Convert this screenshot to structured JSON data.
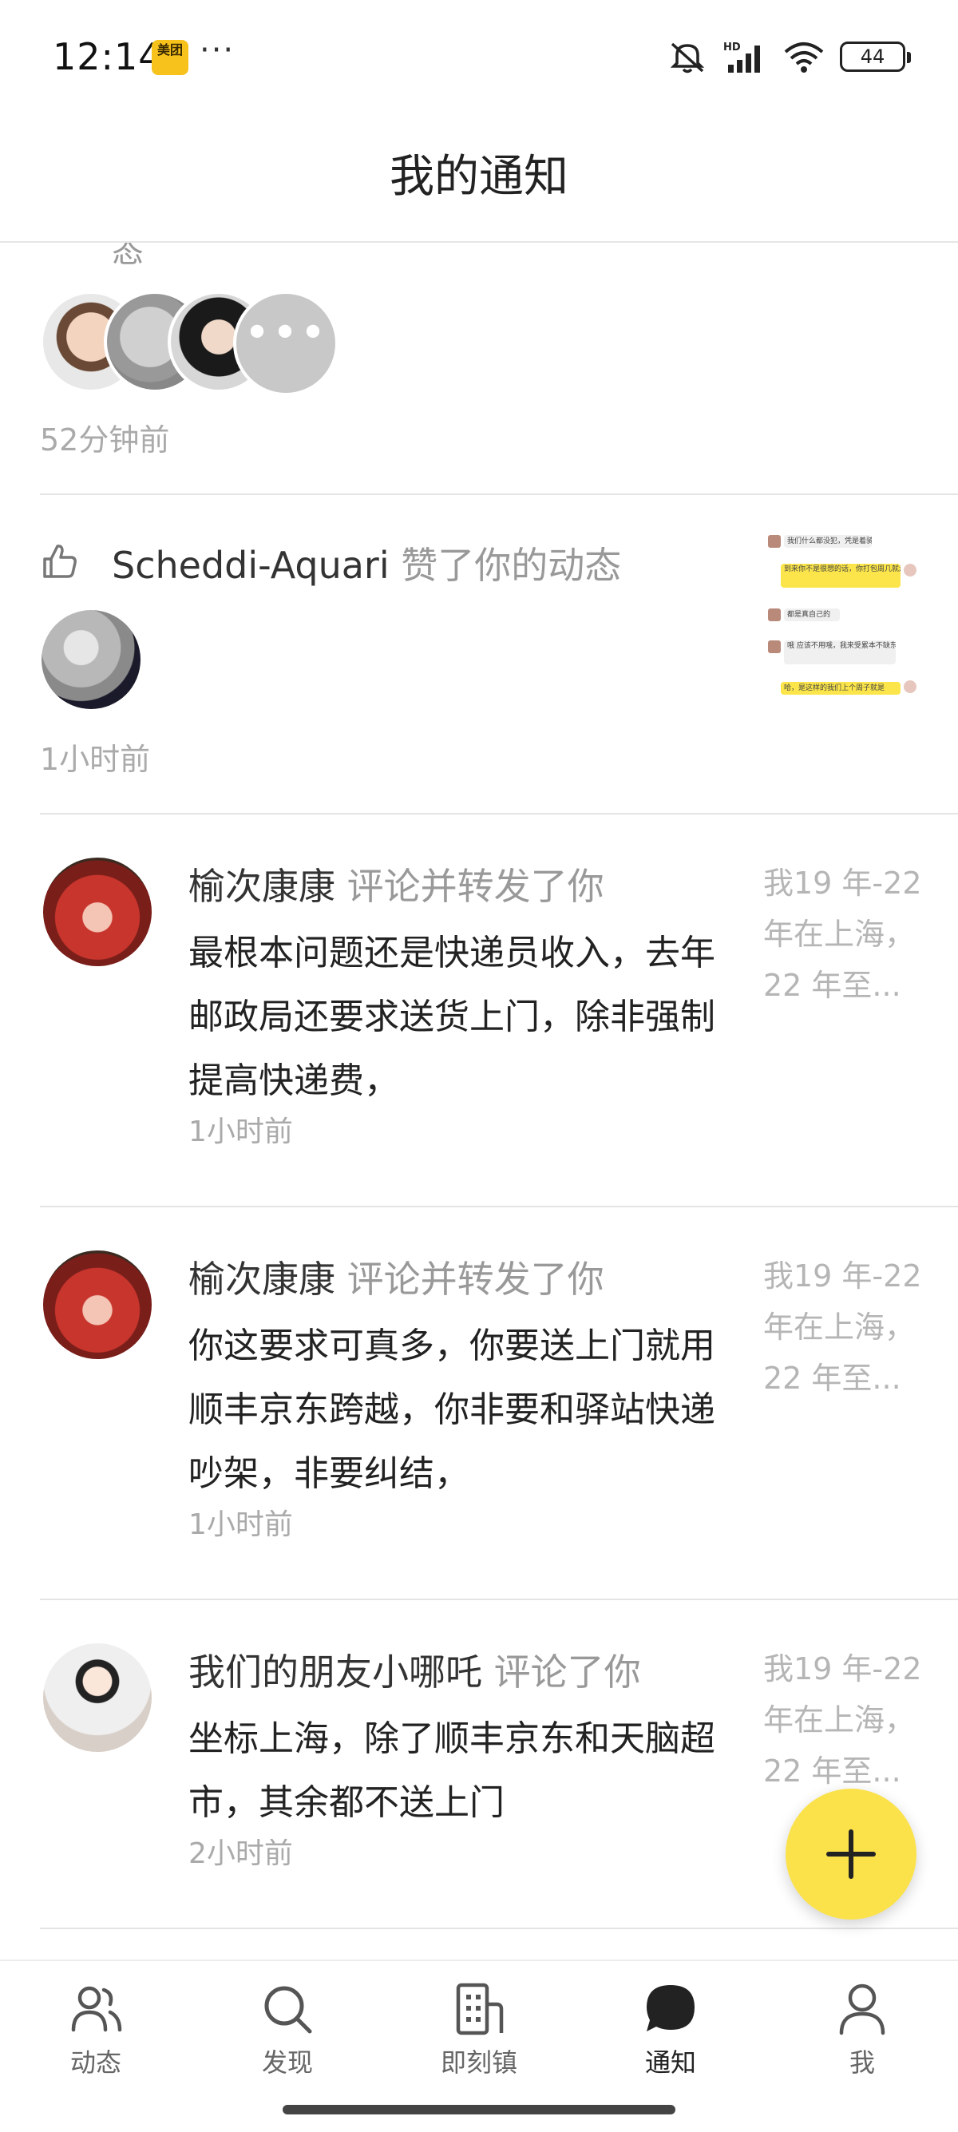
{
  "status_bar": {
    "time": "12:14",
    "app_badge": "美团",
    "battery": "44"
  },
  "header": {
    "title": "我的通知"
  },
  "notifications": [
    {
      "type": "group-like",
      "partial_text": "态",
      "time": "52分钟前"
    },
    {
      "type": "like",
      "user": "Scheddi-Aquari",
      "action": "赞了你的动态",
      "time": "1小时前",
      "thumb_lines": [
        "我们什么都没犯，凭是着骑小",
        "到来你不是很想的话，你打包周几就走好了 可以验件哪里点",
        "都是真自己的",
        "哦 应该不用哦，我来受累本不缺东西，差就行",
        "哈，是这样的我们上个周子就是"
      ]
    },
    {
      "type": "comment",
      "user": "榆次康康",
      "action": "评论并转发了你",
      "content": "最根本问题还是快递员收入，去年邮政局还要求送货上门，除非强制提高快递费，",
      "time": "1小时前",
      "quote": "我19 年-22 年在上海，22 年至..."
    },
    {
      "type": "comment",
      "user": "榆次康康",
      "action": "评论并转发了你",
      "content": "你这要求可真多，你要送上门就用顺丰京东跨越，你非要和驿站快递吵架，非要纠结，",
      "time": "1小时前",
      "quote": "我19 年-22 年在上海，22 年至..."
    },
    {
      "type": "comment",
      "user": "我们的朋友小哪吒",
      "action": "评论了你",
      "content": "坐标上海，除了顺丰京东和天脑超市，其余都不送上门",
      "time": "2小时前",
      "quote": "我19 年-22 年在上海，22 年至..."
    }
  ],
  "bottom_nav": [
    {
      "label": "动态",
      "icon": "people-icon"
    },
    {
      "label": "发现",
      "icon": "search-icon"
    },
    {
      "label": "即刻镇",
      "icon": "building-icon"
    },
    {
      "label": "通知",
      "icon": "chat-bubble-icon",
      "active": true
    },
    {
      "label": "我",
      "icon": "person-icon"
    }
  ],
  "colors": {
    "accent": "#fbe24b",
    "secondary_text": "#999999"
  }
}
